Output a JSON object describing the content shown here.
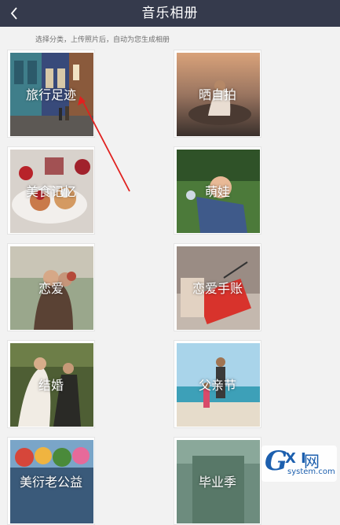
{
  "header": {
    "title": "音乐相册",
    "back_icon": "chevron-left-icon"
  },
  "subtitle": "选择分类，上传照片后，自动为您生成相册",
  "categories": [
    {
      "label": "旅行足迹"
    },
    {
      "label": "晒自拍"
    },
    {
      "label": "美食记忆"
    },
    {
      "label": "萌娃"
    },
    {
      "label": "恋爱"
    },
    {
      "label": "恋爱手账"
    },
    {
      "label": "结婚"
    },
    {
      "label": "父亲节"
    },
    {
      "label": "美衍老公益"
    },
    {
      "label": "毕业季"
    }
  ],
  "watermark": {
    "brand": "GXI网",
    "g": "G",
    "xi": "X I",
    "net": "网",
    "site": "system.com"
  },
  "colors": {
    "header_bg": "#353a4c",
    "background": "#f2f2f2",
    "arrow": "#e0211f",
    "watermark": "#1c5fae"
  }
}
